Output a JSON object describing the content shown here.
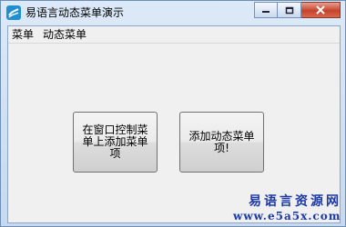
{
  "window": {
    "title": "易语言动态菜单演示",
    "controls": {
      "minimize": "minimize-icon",
      "maximize": "maximize-icon",
      "close": "close-icon"
    }
  },
  "menubar": {
    "items": [
      {
        "label": "菜单"
      },
      {
        "label": "动态菜单"
      }
    ]
  },
  "buttons": {
    "add_in_window": "在窗口控制菜单上添加菜单项",
    "add_dynamic": "添加动态菜单项!"
  },
  "watermark": {
    "line1": "易语言资源网",
    "line2": "www.e5a5x.com"
  },
  "colors": {
    "watermark": "#1d3aa6",
    "title_bar": "#c6d9f0",
    "close": "#c4432b"
  }
}
